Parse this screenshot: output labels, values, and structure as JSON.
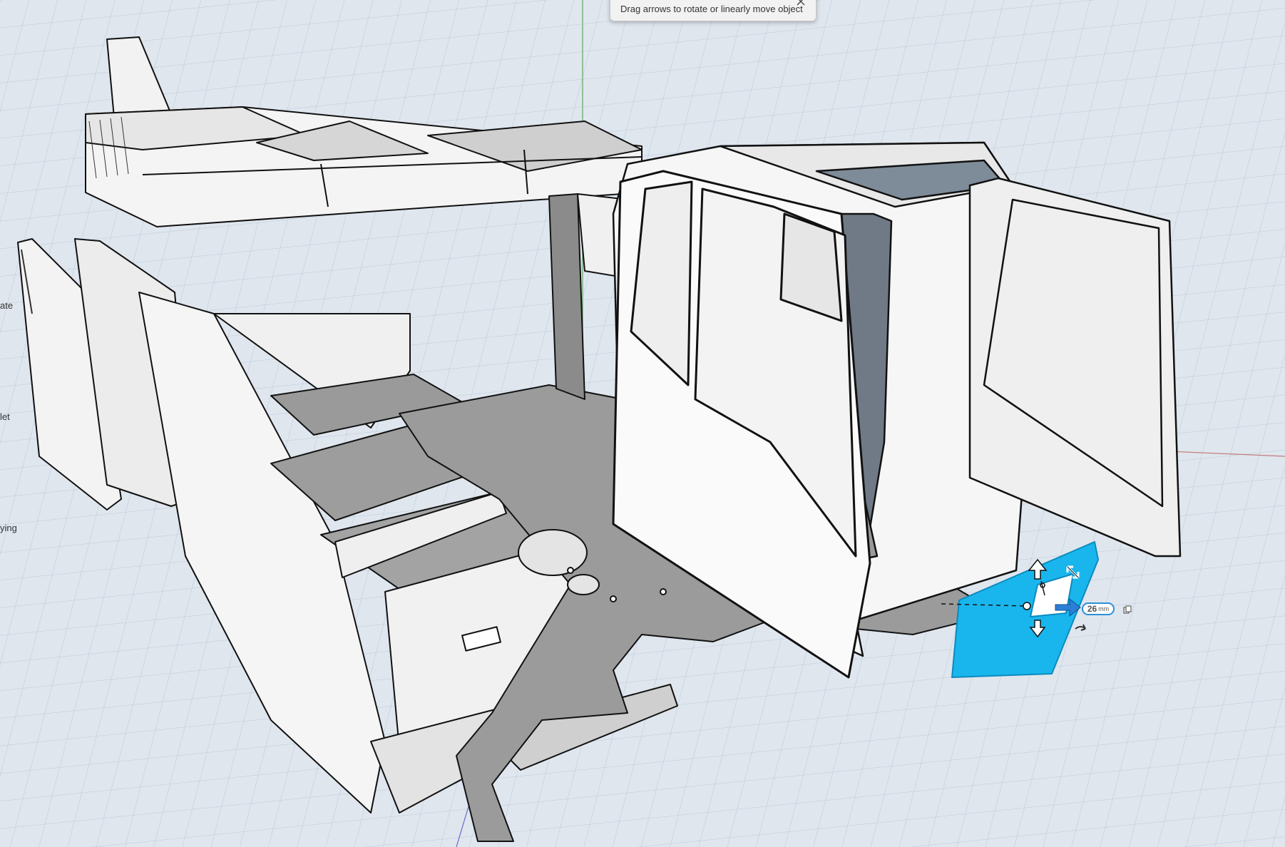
{
  "tooltip": {
    "text": "Drag arrows to rotate or linearly move object"
  },
  "side_labels": [
    "ate",
    "let",
    "ying"
  ],
  "gizmo": {
    "distance_value": "26",
    "distance_unit": "mm"
  },
  "icons": [
    "close-icon",
    "copy-icon",
    "rotate-icon",
    "move-arrow-icon"
  ],
  "colors": {
    "background": "#dfe6ee",
    "grid": "#b9c8d8",
    "selected": "#19b6ee",
    "gizmo_arrow": "#2b7fd6",
    "axis_x": "#c47a7a",
    "axis_y": "#5ea85e",
    "axis_z": "#6b6bc9"
  }
}
